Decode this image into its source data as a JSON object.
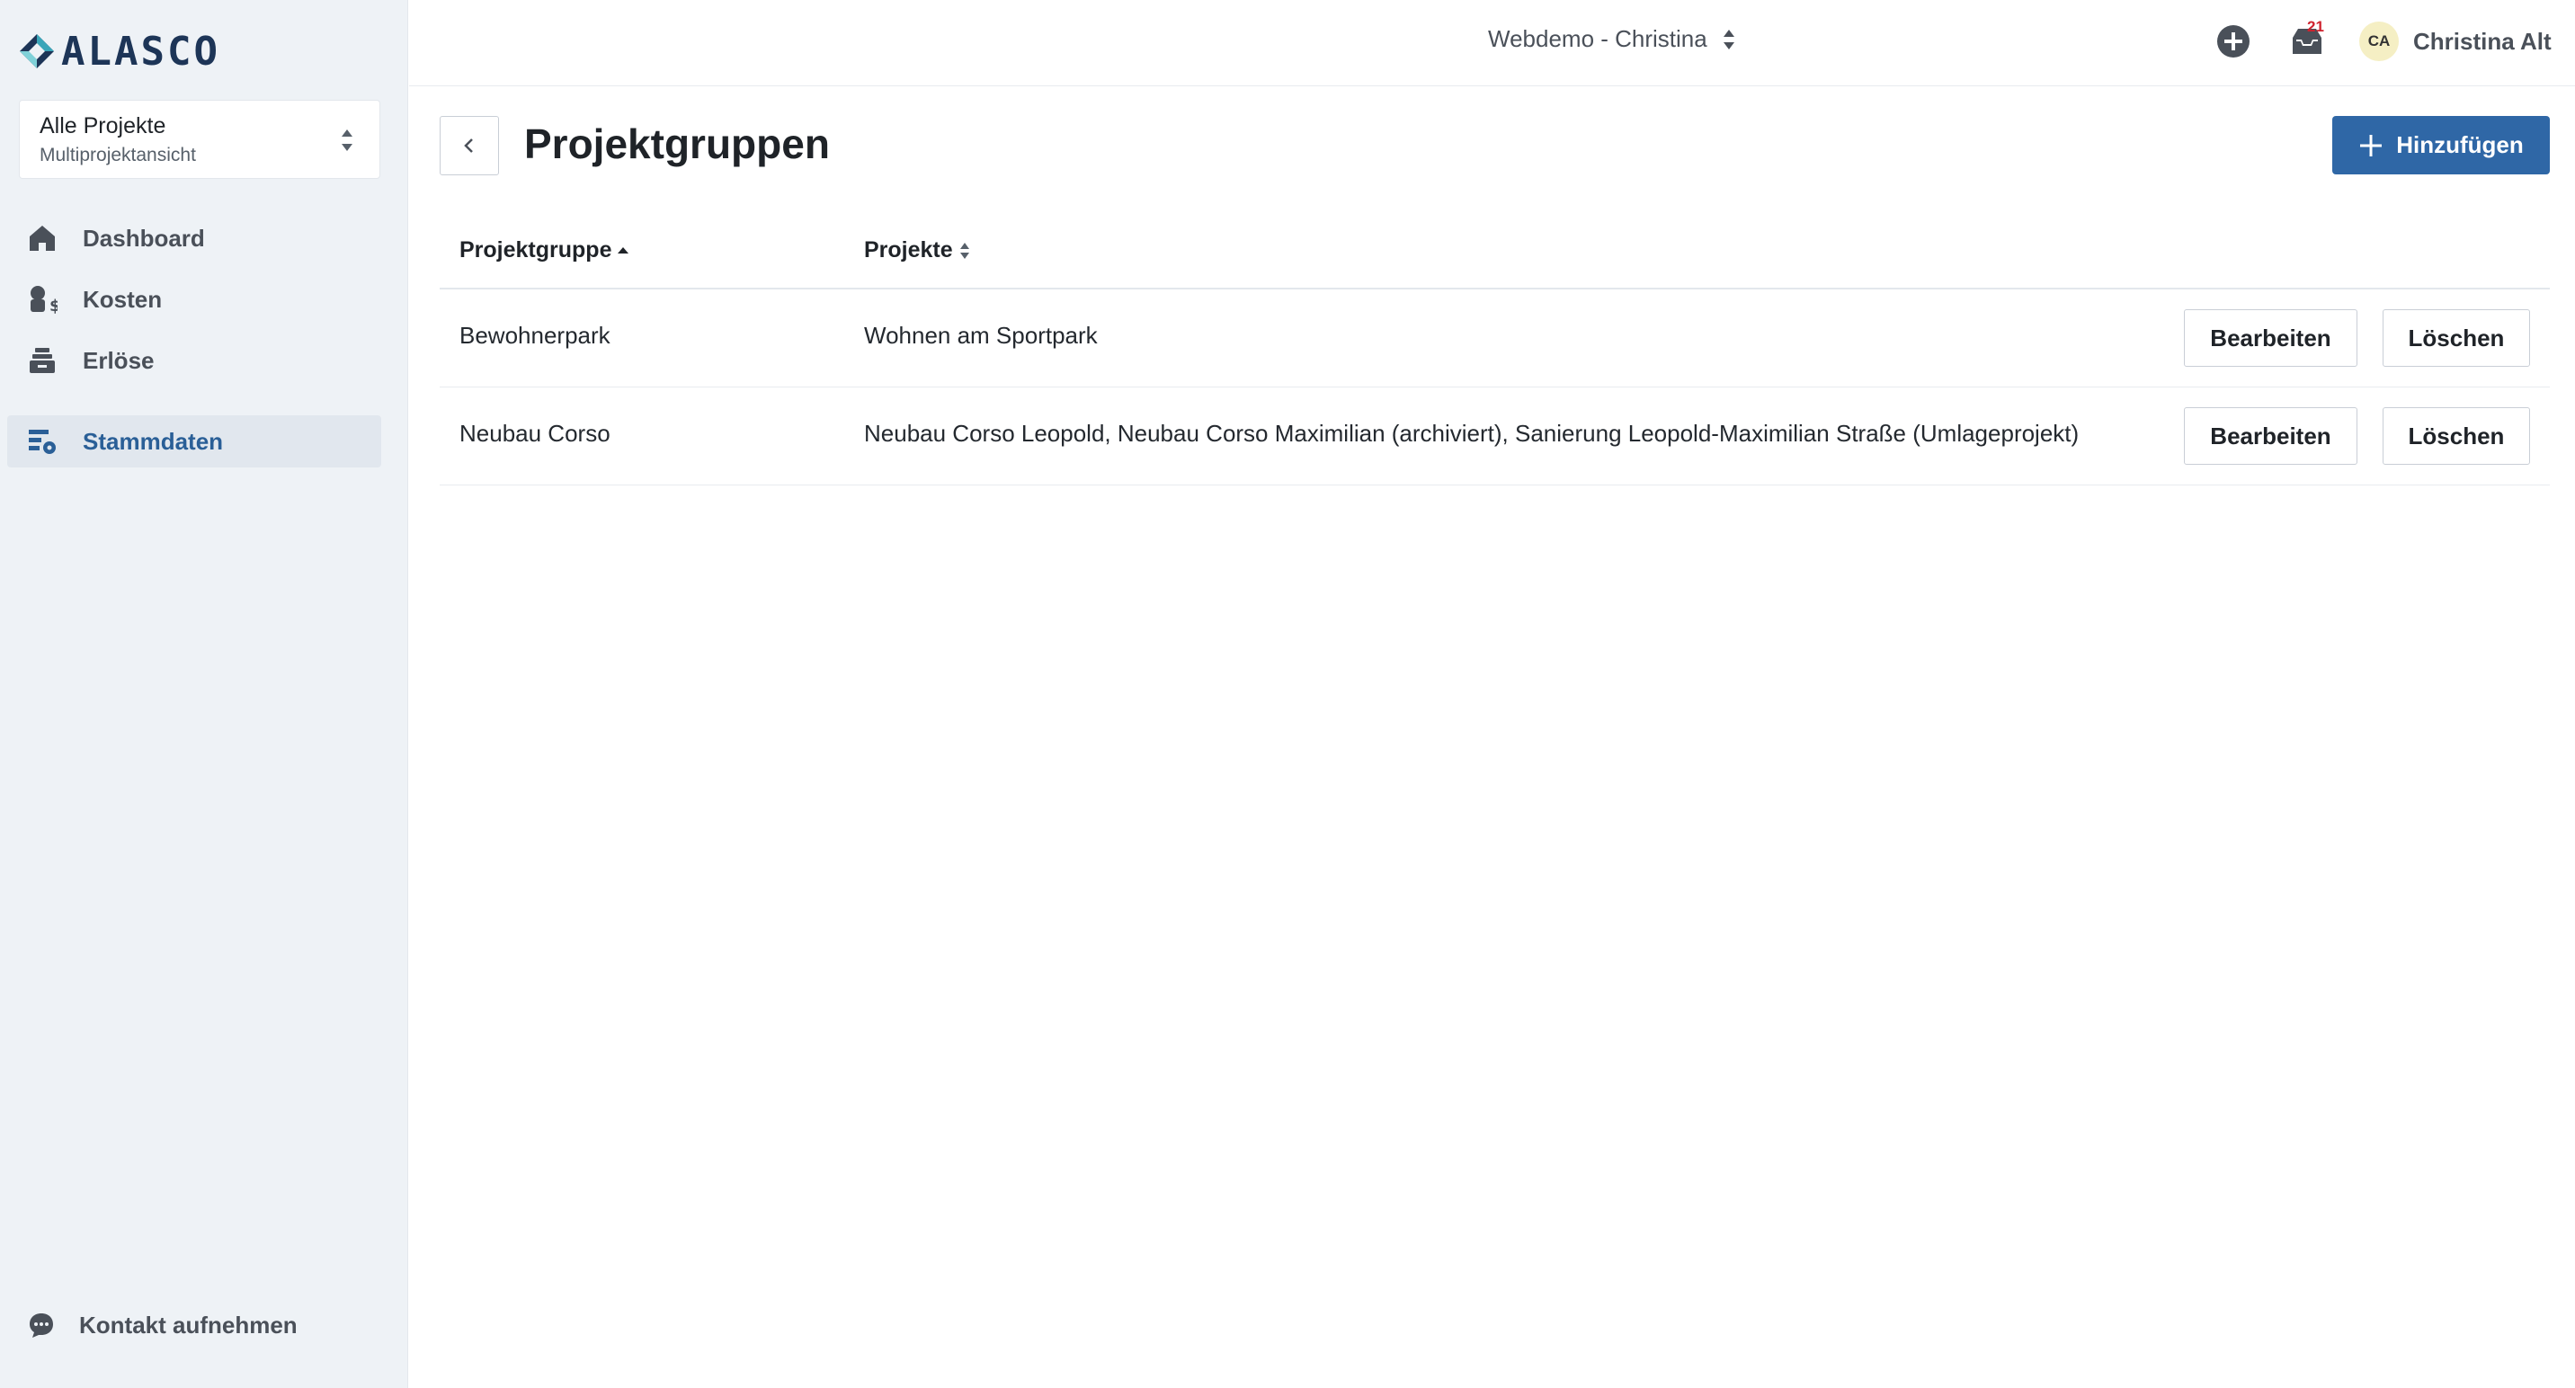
{
  "brand": {
    "name": "ALASCO",
    "accent": "#2f67a6"
  },
  "project_selector": {
    "title": "Alle Projekte",
    "subtitle": "Multiprojektansicht"
  },
  "sidebar": {
    "items": [
      {
        "label": "Dashboard",
        "icon": "home-icon"
      },
      {
        "label": "Kosten",
        "icon": "costs-icon"
      },
      {
        "label": "Erlöse",
        "icon": "revenue-icon"
      },
      {
        "label": "Stammdaten",
        "icon": "master-data-icon",
        "active": true
      }
    ],
    "contact": "Kontakt aufnehmen"
  },
  "topbar": {
    "workspace": "Webdemo - Christina",
    "notifications_count": "21",
    "user_initials": "CA",
    "user_name": "Christina Alt"
  },
  "page": {
    "title": "Projektgruppen",
    "add_button": "Hinzufügen"
  },
  "table": {
    "columns": [
      {
        "label": "Projektgruppe",
        "sort": "ascending"
      },
      {
        "label": "Projekte",
        "sort": "none"
      }
    ],
    "rows": [
      {
        "group": "Bewohnerpark",
        "projects": "Wohnen am Sportpark",
        "edit": "Bearbeiten",
        "delete": "Löschen"
      },
      {
        "group": "Neubau Corso",
        "projects": "Neubau Corso Leopold, Neubau Corso Maximilian (archiviert), Sanierung Leopold-Maximilian Straße (Umlageprojekt)",
        "edit": "Bearbeiten",
        "delete": "Löschen"
      }
    ]
  }
}
